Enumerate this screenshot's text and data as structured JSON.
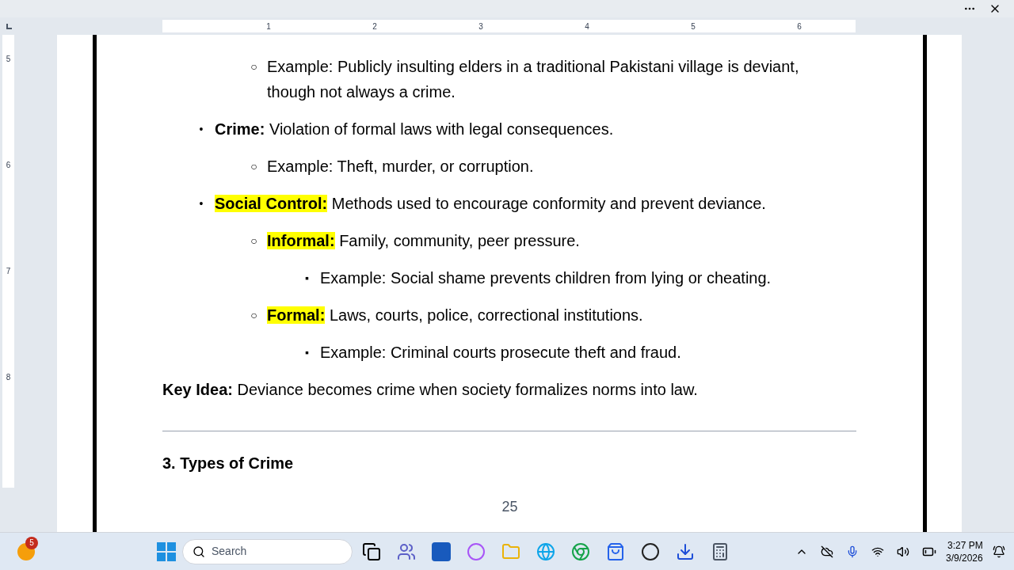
{
  "ruler": {
    "top_numbers": [
      "1",
      "2",
      "3",
      "4",
      "5",
      "6"
    ],
    "side_numbers": [
      "5",
      "6",
      "7",
      "8"
    ]
  },
  "continued_items": [
    {
      "marker": "○",
      "text": "Example: Publicly insulting elders in a traditional Pakistani village is deviant, though not always a crime."
    }
  ],
  "items": [
    {
      "marker": "•",
      "label": "Crime:",
      "highlight": false,
      "text": "Violation of formal laws with legal consequences.",
      "children": [
        {
          "marker": "○",
          "text": "Example: Theft, murder, or corruption."
        }
      ]
    },
    {
      "marker": "•",
      "label": "Social Control:",
      "highlight": true,
      "text": "Methods used to encourage conformity and prevent deviance.",
      "children": [
        {
          "marker": "○",
          "label": "Informal:",
          "highlight": true,
          "text": "Family, community, peer pressure.",
          "children": [
            {
              "marker": "▪",
              "text": "Example: Social shame prevents children from lying or cheating."
            }
          ]
        },
        {
          "marker": "○",
          "label": "Formal:",
          "highlight": true,
          "text": "Laws, courts, police, correctional institutions.",
          "children": [
            {
              "marker": "▪",
              "text": "Example: Criminal courts prosecute theft and fraud."
            }
          ]
        }
      ]
    }
  ],
  "key_idea": {
    "label": "Key Idea:",
    "text": "Deviance becomes crime when society formalizes norms into law."
  },
  "heading": "3. Types of Crime",
  "page_number": "25",
  "taskbar": {
    "weather_badge": "5",
    "search_placeholder": "Search",
    "time": "3:27 PM",
    "date": "3/9/2026"
  }
}
